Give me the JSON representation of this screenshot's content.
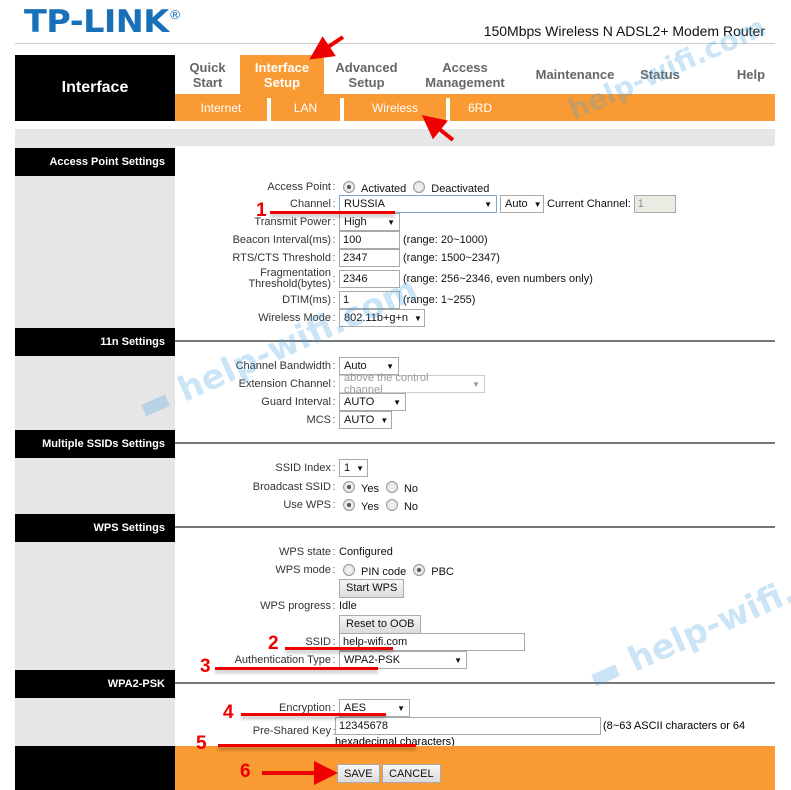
{
  "header": {
    "logo": "TP-LINK",
    "logo_mark": "®",
    "model": "150Mbps Wireless N ADSL2+ Modem Router"
  },
  "brand_section": "Interface",
  "main_nav": [
    {
      "line1": "Quick",
      "line2": "Start",
      "active": false
    },
    {
      "line1": "Interface",
      "line2": "Setup",
      "active": true
    },
    {
      "line1": "Advanced",
      "line2": "Setup",
      "active": false
    },
    {
      "line1": "Access",
      "line2": "Management",
      "active": false
    },
    {
      "line1": "Maintenance",
      "line2": "",
      "active": false
    },
    {
      "line1": "Status",
      "line2": "",
      "active": false
    },
    {
      "line1": "Help",
      "line2": "",
      "active": false
    }
  ],
  "sub_nav": [
    "Internet",
    "LAN",
    "Wireless",
    "6RD"
  ],
  "sections": {
    "ap": "Access Point Settings",
    "n11": "11n Settings",
    "mssid": "Multiple SSIDs Settings",
    "wps": "WPS Settings",
    "wpa": "WPA2-PSK"
  },
  "ap": {
    "access_point": {
      "label": "Access Point",
      "opt1": "Activated",
      "opt2": "Deactivated",
      "selected": "Activated"
    },
    "channel": {
      "label": "Channel",
      "country": "RUSSIA",
      "mode": "Auto",
      "current_label": "Current Channel:",
      "current_value": "1"
    },
    "transmit_power": {
      "label": "Transmit Power",
      "value": "High"
    },
    "beacon": {
      "label": "Beacon Interval(ms)",
      "value": "100",
      "hint": "(range: 20~1000)"
    },
    "rts": {
      "label": "RTS/CTS Threshold",
      "value": "2347",
      "hint": "(range: 1500~2347)"
    },
    "frag": {
      "label1": "Fragmentation",
      "label2": "Threshold(bytes)",
      "value": "2346",
      "hint": "(range: 256~2346, even numbers only)"
    },
    "dtim": {
      "label": "DTIM(ms)",
      "value": "1",
      "hint": "(range: 1~255)"
    },
    "wireless_mode": {
      "label": "Wireless Mode",
      "value": "802.11b+g+n"
    }
  },
  "n11": {
    "bandwidth": {
      "label": "Channel Bandwidth",
      "value": "Auto"
    },
    "extension": {
      "label": "Extension Channel",
      "value": "above the control channel"
    },
    "guard": {
      "label": "Guard Interval",
      "value": "AUTO"
    },
    "mcs": {
      "label": "MCS",
      "value": "AUTO"
    }
  },
  "mssid": {
    "index": {
      "label": "SSID Index",
      "value": "1"
    },
    "broadcast": {
      "label": "Broadcast SSID",
      "yes": "Yes",
      "no": "No",
      "selected": "Yes"
    },
    "use_wps": {
      "label": "Use WPS",
      "yes": "Yes",
      "no": "No",
      "selected": "Yes"
    }
  },
  "wps": {
    "state": {
      "label": "WPS state",
      "value": "Configured"
    },
    "mode": {
      "label": "WPS mode",
      "opt1": "PIN code",
      "opt2": "PBC",
      "selected": "PBC"
    },
    "start_button": "Start WPS",
    "progress": {
      "label": "WPS progress",
      "value": "Idle"
    },
    "reset_button": "Reset to OOB",
    "ssid": {
      "label": "SSID",
      "value": "help-wifi.com"
    },
    "auth": {
      "label": "Authentication Type",
      "value": "WPA2-PSK"
    }
  },
  "wpa": {
    "encryption": {
      "label": "Encryption",
      "value": "AES"
    },
    "psk": {
      "label": "Pre-Shared Key",
      "value": "12345678",
      "hint1": "(8~63 ASCII characters or 64",
      "hint2": "hexadecimal characters)"
    }
  },
  "footer": {
    "save": "SAVE",
    "cancel": "CANCEL"
  },
  "annotations": [
    "1",
    "2",
    "3",
    "4",
    "5",
    "6"
  ],
  "watermark": "help-wifi.com",
  "colors": {
    "brand_blue": "#1770b8",
    "accent_orange": "#f99a33",
    "annotation_red": "#e00000"
  }
}
